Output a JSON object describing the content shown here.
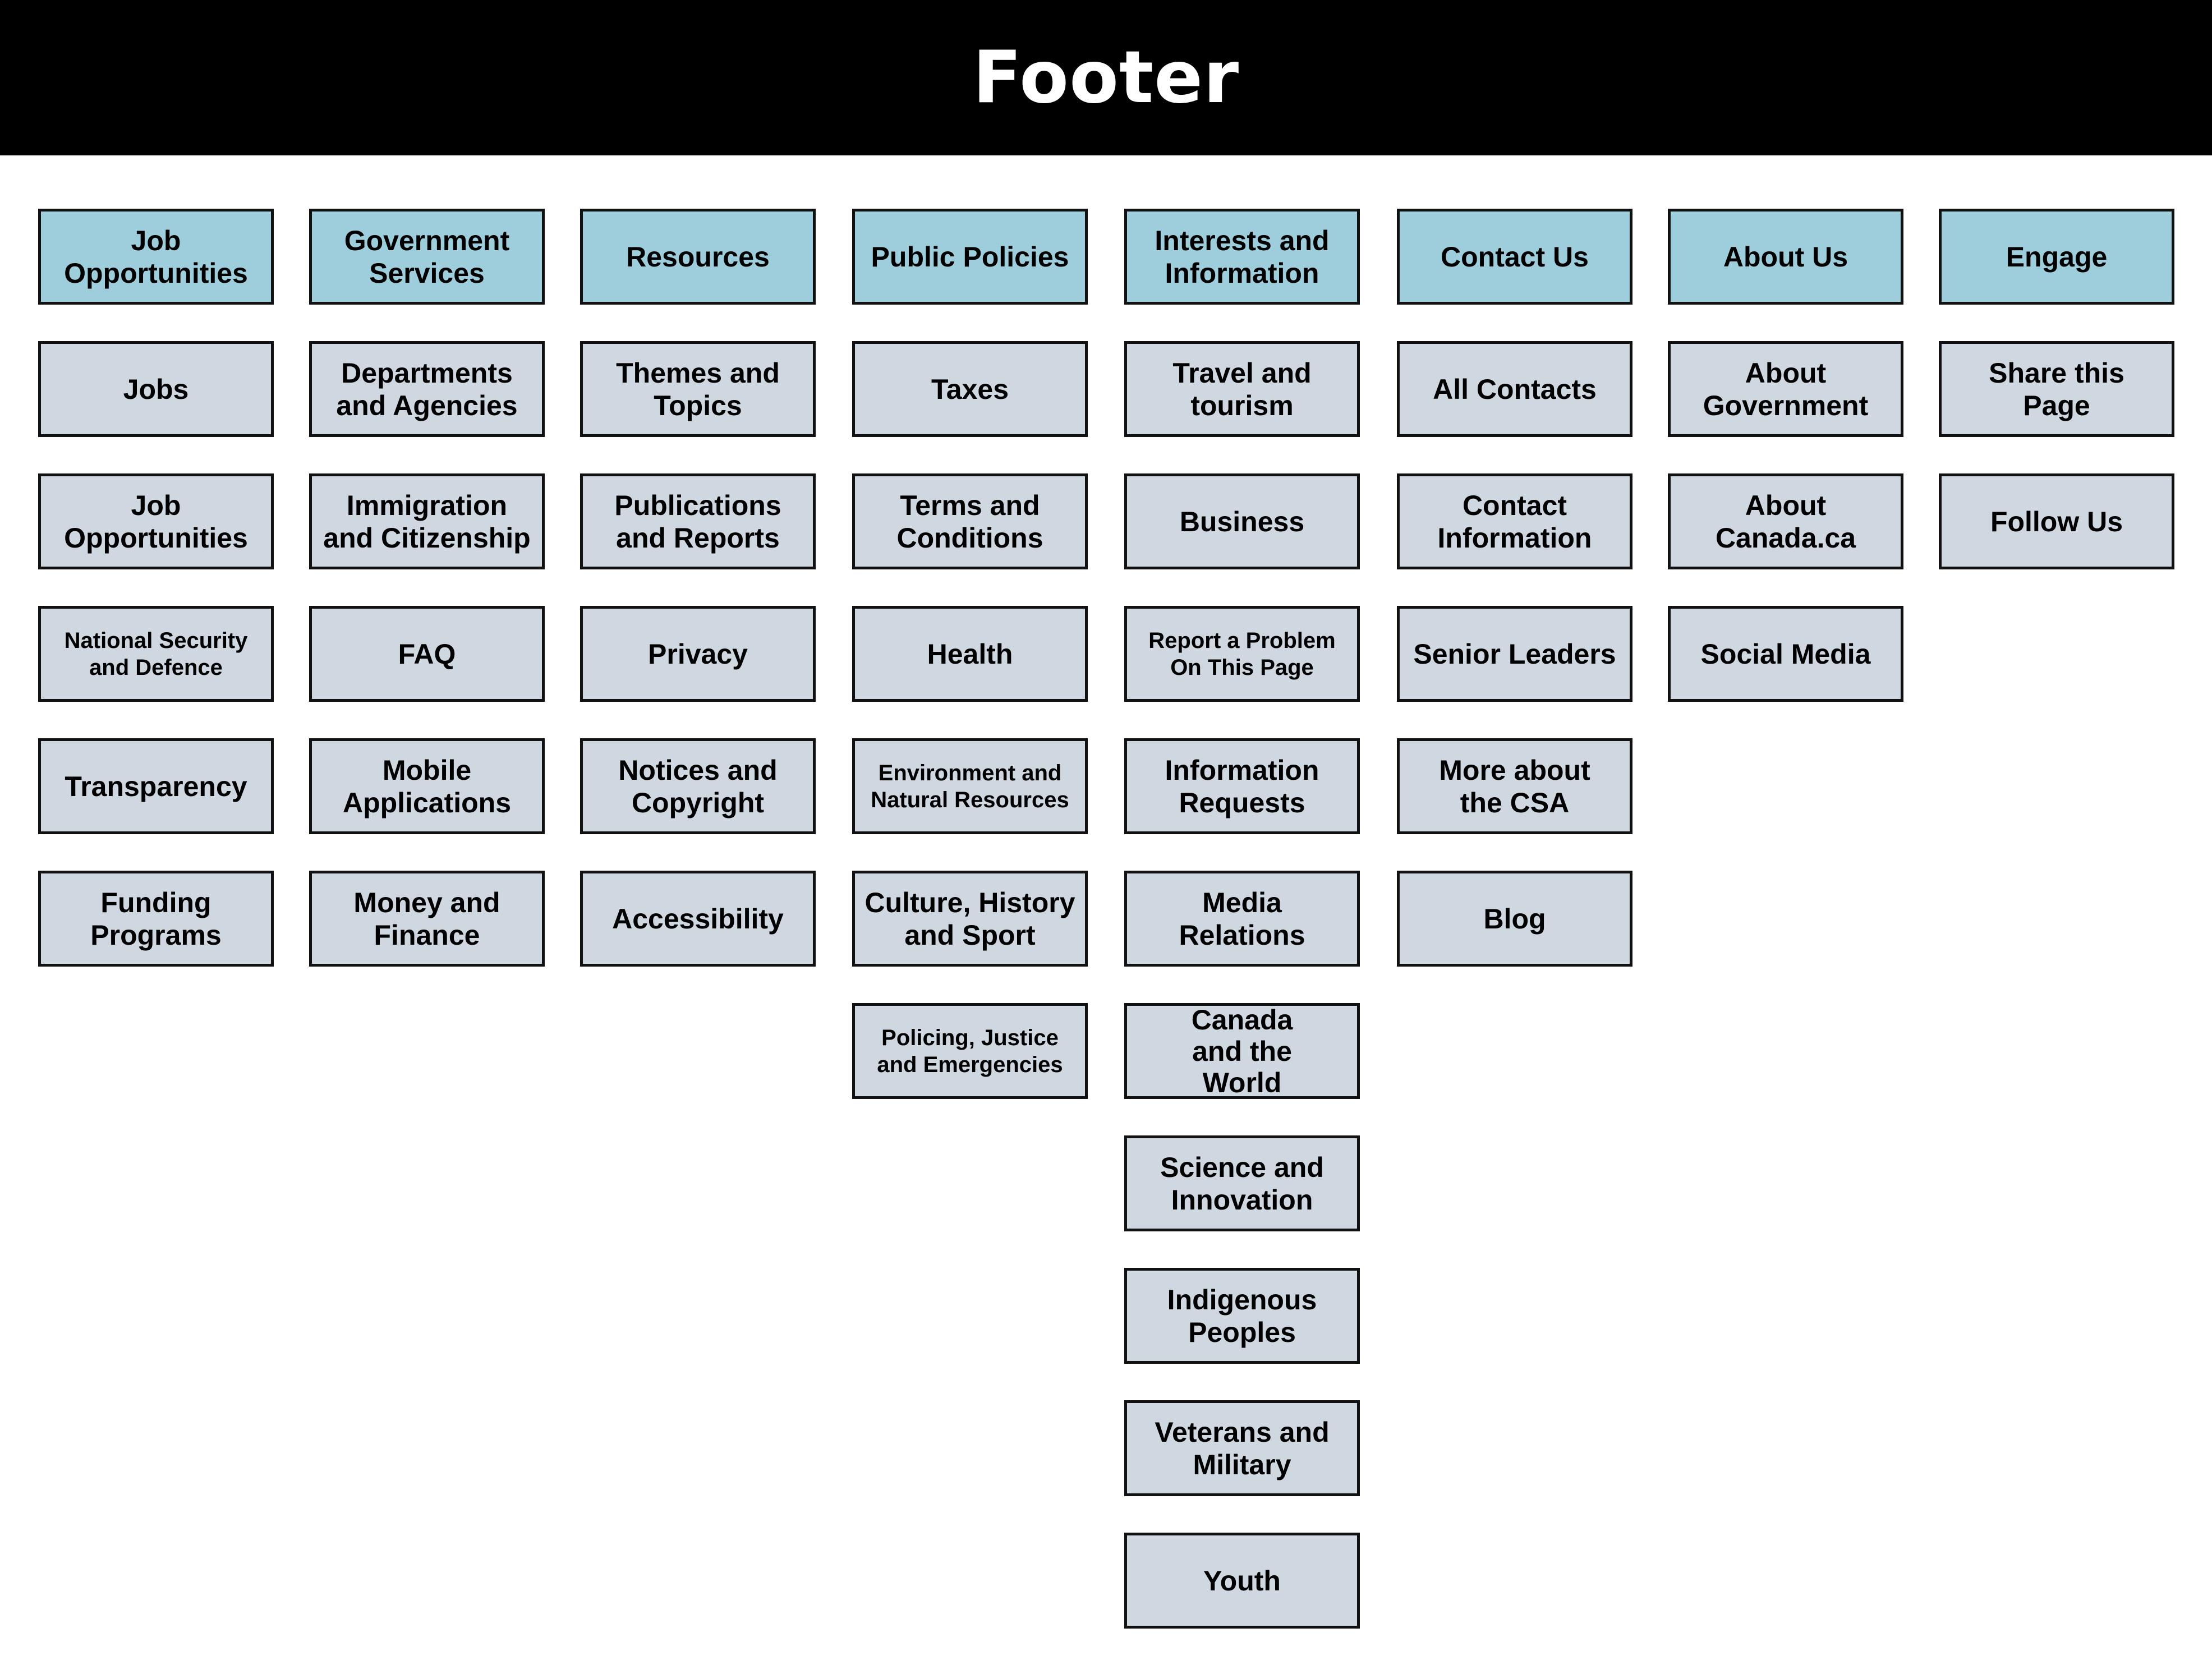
{
  "header": {
    "title": "Footer"
  },
  "colors": {
    "header_bg": "#000000",
    "header_text": "#ffffff",
    "category_fill": "#9ecddc",
    "item_fill": "#cfd7e0",
    "border": "#111111"
  },
  "columns": [
    {
      "heading": "Job\nOpportunities",
      "items": [
        {
          "label": "Jobs"
        },
        {
          "label": "Job\nOpportunities"
        },
        {
          "label": "National Security\nand Defence",
          "small": true
        },
        {
          "label": "Transparency"
        },
        {
          "label": "Funding\nPrograms"
        }
      ]
    },
    {
      "heading": "Government\nServices",
      "items": [
        {
          "label": "Departments\nand Agencies"
        },
        {
          "label": "Immigration\nand Citizenship"
        },
        {
          "label": "FAQ"
        },
        {
          "label": "Mobile\nApplications"
        },
        {
          "label": "Money and\nFinance"
        }
      ]
    },
    {
      "heading": "Resources",
      "items": [
        {
          "label": "Themes and\nTopics"
        },
        {
          "label": "Publications\nand Reports"
        },
        {
          "label": "Privacy"
        },
        {
          "label": "Notices and\nCopyright"
        },
        {
          "label": "Accessibility"
        }
      ]
    },
    {
      "heading": "Public Policies",
      "items": [
        {
          "label": "Taxes"
        },
        {
          "label": "Terms and\nConditions"
        },
        {
          "label": "Health"
        },
        {
          "label": "Environment and\nNatural Resources",
          "small": true
        },
        {
          "label": "Culture, History\nand Sport"
        },
        {
          "label": "Policing, Justice\nand Emergencies",
          "small": true
        }
      ]
    },
    {
      "heading": "Interests and\nInformation",
      "items": [
        {
          "label": "Travel and\ntourism"
        },
        {
          "label": "Business"
        },
        {
          "label": "Report a Problem\nOn This Page",
          "small": true
        },
        {
          "label": "Information\nRequests"
        },
        {
          "label": "Media\nRelations"
        },
        {
          "label": "Canada\nand the\nWorld",
          "tight": true
        },
        {
          "label": "Science and\nInnovation"
        },
        {
          "label": "Indigenous\nPeoples"
        },
        {
          "label": "Veterans and\nMilitary"
        },
        {
          "label": "Youth"
        }
      ]
    },
    {
      "heading": "Contact Us",
      "items": [
        {
          "label": "All Contacts"
        },
        {
          "label": "Contact\nInformation"
        },
        {
          "label": "Senior Leaders"
        },
        {
          "label": "More about\nthe CSA"
        },
        {
          "label": "Blog"
        }
      ]
    },
    {
      "heading": "About Us",
      "items": [
        {
          "label": "About\nGovernment"
        },
        {
          "label": "About\nCanada.ca"
        },
        {
          "label": "Social Media"
        }
      ]
    },
    {
      "heading": "Engage",
      "items": [
        {
          "label": "Share this\nPage"
        },
        {
          "label": "Follow Us"
        }
      ]
    }
  ]
}
